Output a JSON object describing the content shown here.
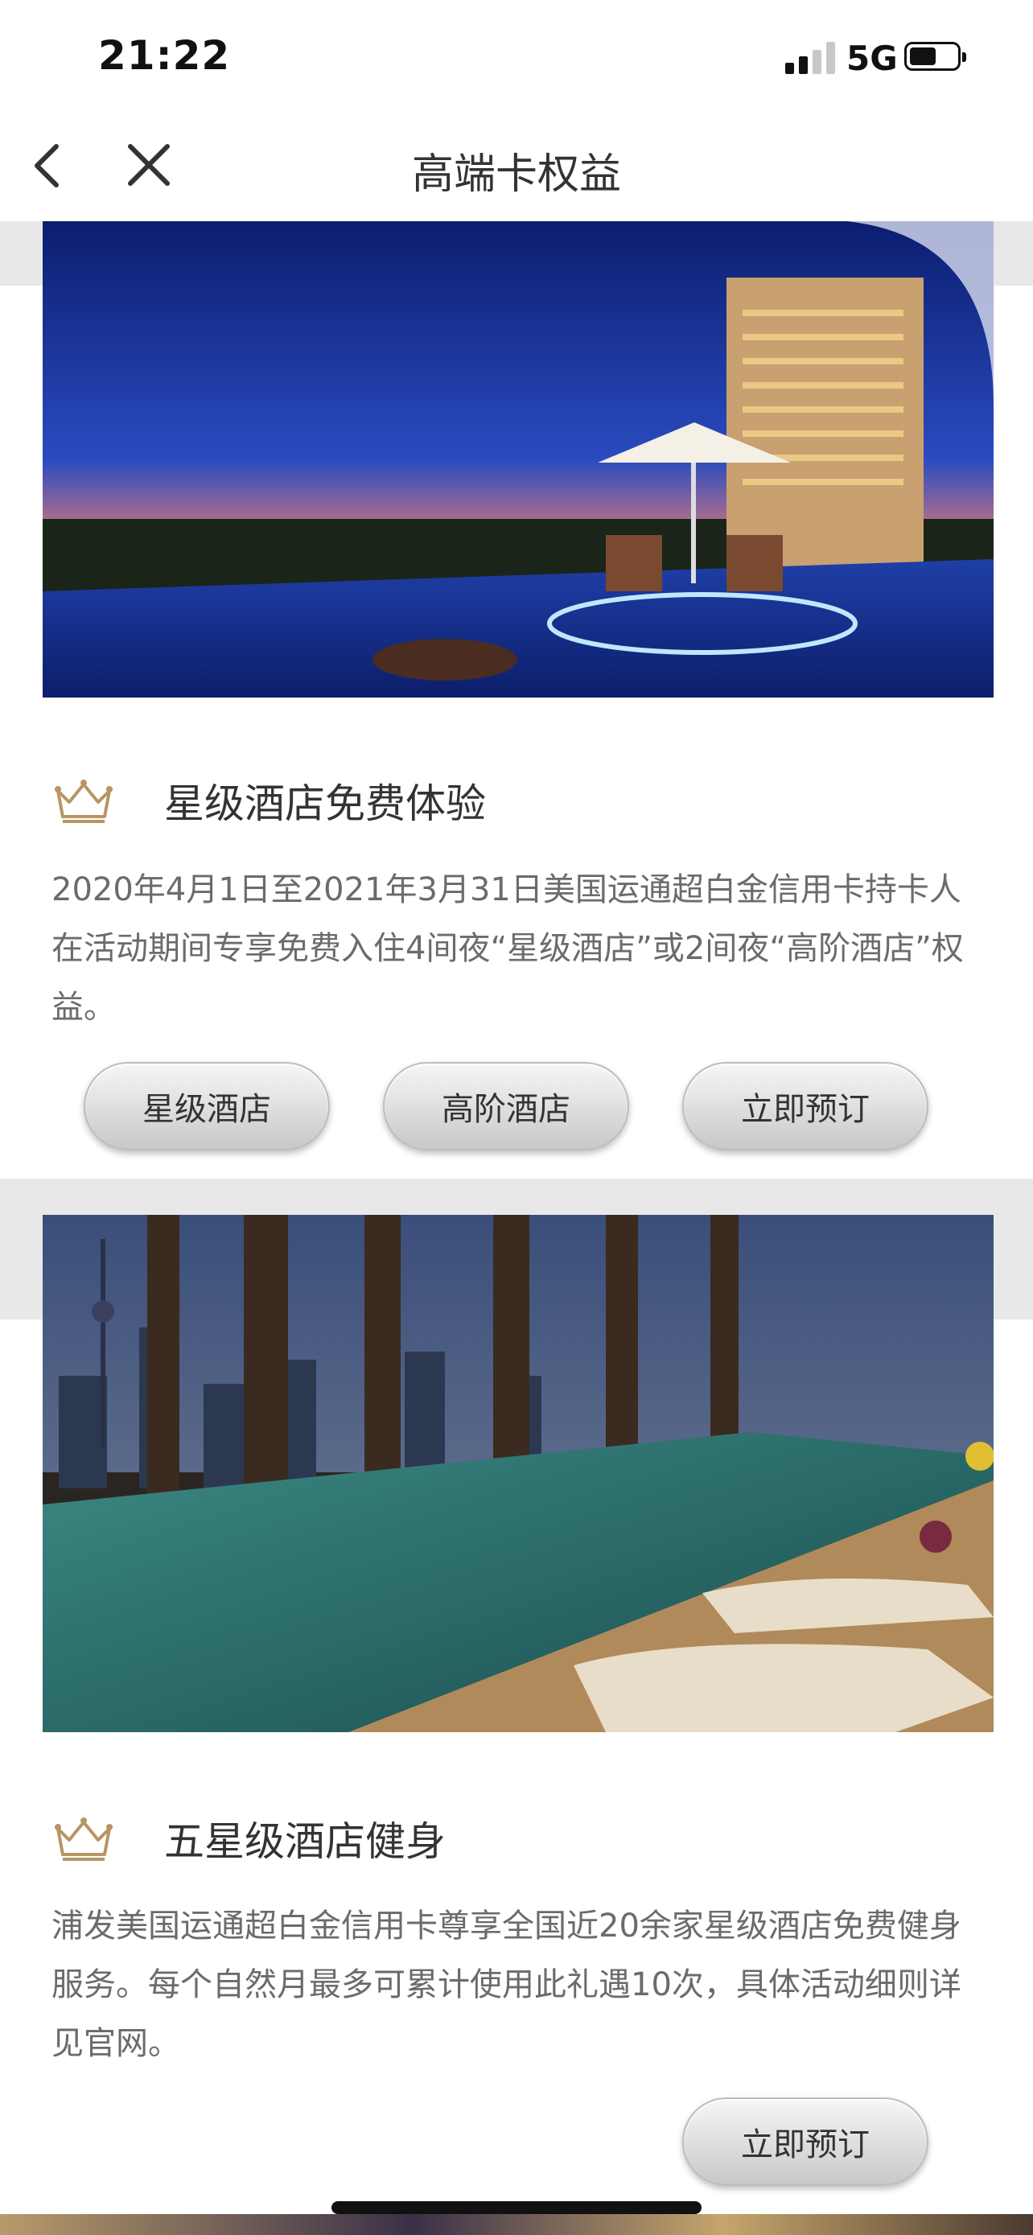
{
  "status_bar": {
    "time": "21:22",
    "network": "5G",
    "signal_bars_active": 2,
    "battery_level": 0.45
  },
  "nav": {
    "title": "高端卡权益",
    "back_icon": "chevron-left-icon",
    "close_icon": "close-icon"
  },
  "benefits": [
    {
      "icon": "crown-icon",
      "title": "星级酒店免费体验",
      "description": "2020年4月1日至2021年3月31日美国运通超白金信用卡持卡人在活动期间专享免费入住4间夜“星级酒店”或2间夜“高阶酒店”权益。",
      "buttons": [
        "星级酒店",
        "高阶酒店",
        "立即预订"
      ]
    },
    {
      "icon": "crown-icon",
      "title": "五星级酒店健身",
      "description": "浦发美国运通超白金信用卡尊享全国近20余家星级酒店免费健身服务。每个自然月最多可累计使用此礼遇10次，具体活动细则详见官网。",
      "buttons": [
        "立即预订"
      ]
    }
  ],
  "colors": {
    "crown_gold": "#b89563",
    "page_bg": "#ffffff",
    "strip_gray": "#e8e8e8"
  }
}
